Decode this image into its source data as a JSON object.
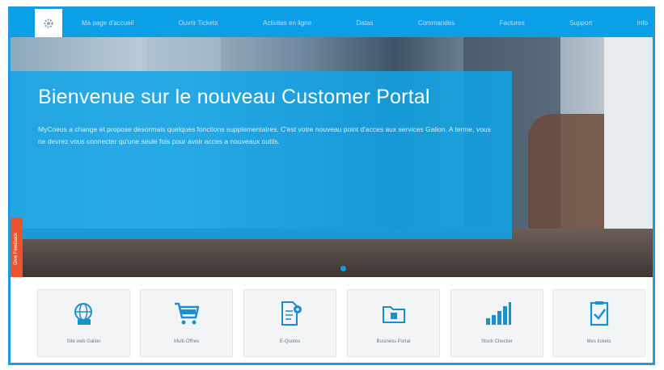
{
  "nav": {
    "home_icon": "gear-icon",
    "items": [
      "Ma page d'accueil",
      "Ouvrir Tickets",
      "Activites en ligne",
      "Datas",
      "Commandes",
      "Factures",
      "Support",
      "Info"
    ]
  },
  "hero": {
    "title": "Bienvenue sur le nouveau Customer Portal",
    "body": "MyCoeus a change et propose desormais quelques fonctions supplementaires. C'est votre nouveau point d'acces aux services Galion. A terme, vous ne devrez vous connecter qu'une seule fois pour avoir acces a nouveaux outils.",
    "feedback_label": "Give Feedback"
  },
  "tiles": [
    {
      "label": "Site web Galion",
      "icon": "globe-dollar-icon"
    },
    {
      "label": "Multi-Offres",
      "icon": "shopping-cart-icon"
    },
    {
      "label": "E-Quotes",
      "icon": "document-gear-icon"
    },
    {
      "label": "Business Portal",
      "icon": "folder-icon"
    },
    {
      "label": "Stock Checker",
      "icon": "bar-signal-icon"
    },
    {
      "label": "Mes tickets",
      "icon": "clipboard-check-icon"
    }
  ],
  "colors": {
    "accent": "#0a9fe6",
    "feedback": "#e8542f"
  }
}
